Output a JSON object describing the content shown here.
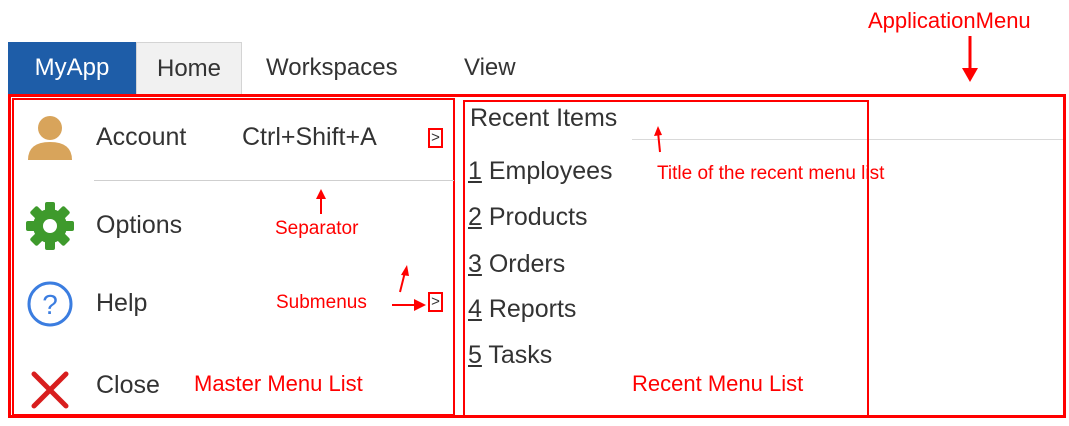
{
  "tabs": {
    "app": "MyApp",
    "home": "Home",
    "workspaces": "Workspaces",
    "view": "View"
  },
  "master_menu": {
    "account": {
      "label": "Account",
      "shortcut": "Ctrl+Shift+A",
      "submenu_arrow": ">"
    },
    "options": {
      "label": "Options"
    },
    "help": {
      "label": "Help",
      "submenu_arrow": ">"
    },
    "close": {
      "label": "Close"
    }
  },
  "recent": {
    "title": "Recent Items",
    "items": [
      {
        "num": "1",
        "label": " Employees"
      },
      {
        "num": "2",
        "label": " Products"
      },
      {
        "num": "3",
        "label": " Orders"
      },
      {
        "num": "4",
        "label": " Reports"
      },
      {
        "num": "5",
        "label": " Tasks"
      }
    ]
  },
  "annotations": {
    "application_menu": "ApplicationMenu",
    "recent_title_note": "Title of the recent menu list",
    "separator": "Separator",
    "submenus": "Submenus",
    "master_list": "Master Menu List",
    "recent_list": "Recent Menu List"
  },
  "colors": {
    "accent": "#1e5da8",
    "annotation": "#ff0000",
    "options_icon": "#3e9a2c",
    "help_icon": "#3b7de0",
    "close_icon": "#d81e1e",
    "account_icon": "#d8a45b"
  }
}
